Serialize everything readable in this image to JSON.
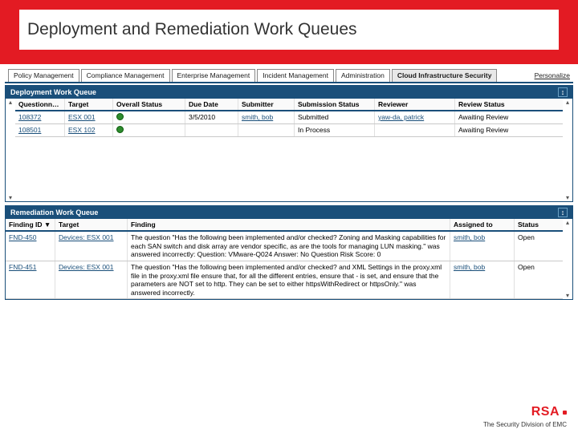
{
  "page_title": "Deployment and Remediation Work Queues",
  "nav": {
    "tabs": [
      "Policy Management",
      "Compliance Management",
      "Enterprise Management",
      "Incident Management",
      "Administration",
      "Cloud Infrastructure Security"
    ],
    "active_index": 5,
    "personalize": "Personalize"
  },
  "dwq": {
    "title": "Deployment Work Queue",
    "headers": [
      "Questionna...",
      "Target",
      "Overall Status",
      "Due Date",
      "Submitter",
      "Submission Status",
      "Reviewer",
      "Review Status"
    ],
    "rows": [
      {
        "questionnaire": "108372",
        "target": "ESX 001",
        "status_color": "green",
        "due": "3/5/2010",
        "submitter": "smith, bob",
        "sub_status": "Submitted",
        "reviewer": "yaw-da, patrick",
        "rev_status": "Awaiting Review"
      },
      {
        "questionnaire": "108501",
        "target": "ESX 102",
        "status_color": "green",
        "due": "",
        "submitter": "",
        "sub_status": "In Process",
        "reviewer": "",
        "rev_status": "Awaiting Review"
      }
    ]
  },
  "rwq": {
    "title": "Remediation Work Queue",
    "headers": [
      "Finding ID",
      "Target",
      "Finding",
      "Assigned to",
      "Status"
    ],
    "rows": [
      {
        "id": "FND-450",
        "target": "Devices: ESX 001",
        "finding": "The question \"Has the following been implemented and/or checked? Zoning and Masking capabilities for each SAN switch and disk array are vendor specific, as are the tools for managing LUN masking.\" was answered incorrectly:\nQuestion: VMware-Q024\nAnswer: No\nQuestion Risk Score: 0",
        "assigned": "smith, bob",
        "status": "Open"
      },
      {
        "id": "FND-451",
        "target": "Devices: ESX 001",
        "finding": "The question \"Has the following been implemented and/or checked? and XML Settings in the proxy.xml file in the proxy.xml file ensure that, for all the different entries, ensure that - is set, and ensure that the parameters are NOT set to http. They can be set to either httpsWithRedirect or httpsOnly.\" was answered incorrectly.",
        "assigned": "smith, bob",
        "status": "Open"
      }
    ]
  },
  "branding": {
    "mark": "RSA",
    "tagline": "The Security Division of EMC"
  }
}
